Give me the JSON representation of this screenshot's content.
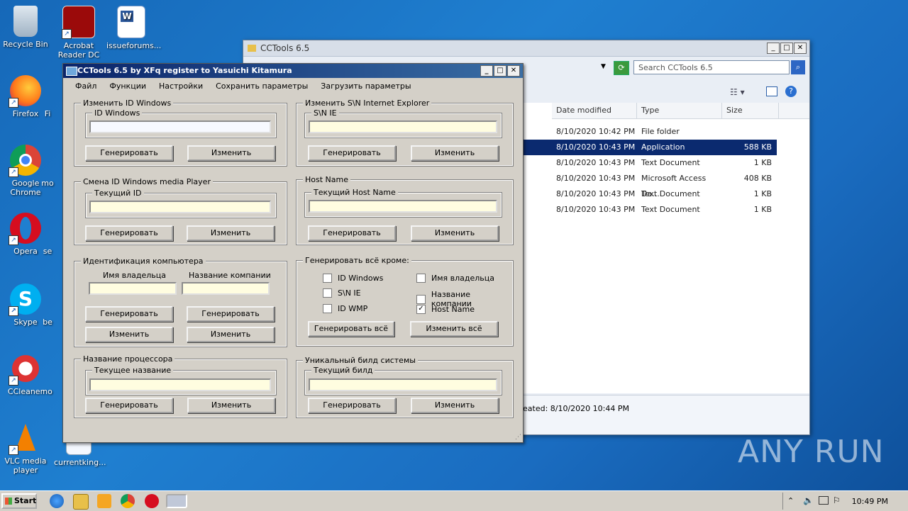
{
  "desktop": {
    "icons": [
      {
        "label": "Recycle Bin"
      },
      {
        "label": "Acrobat Reader DC"
      },
      {
        "label": "issueforums..."
      },
      {
        "label": "Firefox"
      },
      {
        "label": "Fi"
      },
      {
        "label": "Google Chrome"
      },
      {
        "label": "mo"
      },
      {
        "label": "Opera"
      },
      {
        "label": "se"
      },
      {
        "label": "Skype"
      },
      {
        "label": "be"
      },
      {
        "label": "CCleaner"
      },
      {
        "label": "no"
      },
      {
        "label": "VLC media player"
      },
      {
        "label": "currentking..."
      }
    ]
  },
  "explorer": {
    "title": "CCTools 6.5",
    "search_placeholder": "Search CCTools 6.5",
    "columns": [
      "Date modified",
      "Type",
      "Size"
    ],
    "rows": [
      {
        "date": "8/10/2020 10:42 PM",
        "type": "File folder",
        "size": ""
      },
      {
        "date": "8/10/2020 10:43 PM",
        "type": "Application",
        "size": "588 KB"
      },
      {
        "date": "8/10/2020 10:43 PM",
        "type": "Text Document",
        "size": "1 KB"
      },
      {
        "date": "8/10/2020 10:43 PM",
        "type": "Microsoft Access Da...",
        "size": "408 KB"
      },
      {
        "date": "8/10/2020 10:43 PM",
        "type": "Text Document",
        "size": "1 KB"
      },
      {
        "date": "8/10/2020 10:43 PM",
        "type": "Text Document",
        "size": "1 KB"
      }
    ],
    "status": "eated: 8/10/2020 10:44 PM"
  },
  "dialog": {
    "title": "CCTools 6.5 by XFq register to Yasuichi Kitamura",
    "menu": [
      "Файл",
      "Функции",
      "Настройки",
      "Сохранить параметры",
      "Загрузить параметры"
    ],
    "g1": {
      "title": "Изменить ID Windows",
      "sub": "ID Windows",
      "b1": "Генерировать",
      "b2": "Изменить"
    },
    "g2": {
      "title": "Изменить S\\N Internet Explorer",
      "sub": "S\\N IE",
      "b1": "Генерировать",
      "b2": "Изменить"
    },
    "g3": {
      "title": "Смена ID Windows media Player",
      "sub": "Текущий ID",
      "b1": "Генерировать",
      "b2": "Изменить"
    },
    "g4": {
      "title": "Host Name",
      "sub": "Текущий Host Name",
      "b1": "Генерировать",
      "b2": "Изменить"
    },
    "g5": {
      "title": "Идентификация компьютера",
      "owner": "Имя владельца",
      "company": "Название компании",
      "b1": "Генерировать",
      "b2": "Генерировать",
      "b3": "Изменить",
      "b4": "Изменить"
    },
    "g6": {
      "title": "Генерировать всё кроме:",
      "c1": "ID Windows",
      "c2": "S\\N IE",
      "c3": "ID WMP",
      "c4": "Имя владельца",
      "c5": "Название компании",
      "c6": "Host Name",
      "b1": "Генерировать всё",
      "b2": "Изменить всё"
    },
    "g7": {
      "title": "Название процессора",
      "sub": "Текущее название",
      "b1": "Генерировать",
      "b2": "Изменить"
    },
    "g8": {
      "title": "Уникальный билд системы",
      "sub": "Текущий билд",
      "b1": "Генерировать",
      "b2": "Изменить"
    }
  },
  "taskbar": {
    "start": "Start",
    "clock": "10:49 PM"
  },
  "watermark": "ANY RUN"
}
